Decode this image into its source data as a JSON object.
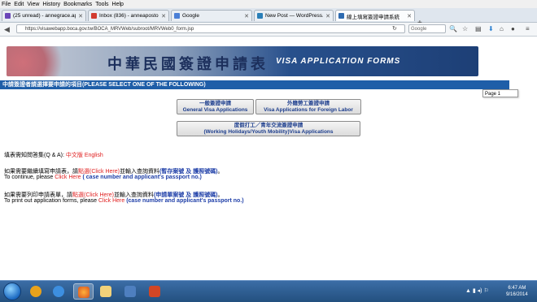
{
  "menu": [
    "File",
    "Edit",
    "View",
    "History",
    "Bookmarks",
    "Tools",
    "Help"
  ],
  "tabs": [
    {
      "title": "(25 unread) - annegrace.ap...",
      "color": "#6a46b8"
    },
    {
      "title": "Inbox (836) - anneaposto...",
      "color": "#d23b2f"
    },
    {
      "title": "Google",
      "color": "#4a7fd6"
    },
    {
      "title": "New Post — WordPress.com",
      "color": "#2a7fb8"
    },
    {
      "title": "線上填寫簽證申請系統",
      "color": "#2e6bb0"
    }
  ],
  "url": "https://visawebapp.boca.gov.tw/BOCA_MRVWeb/subroot/MRVWeb0_form.jsp",
  "search_placeholder": "Google",
  "banner": {
    "zh": "中華民國簽證申請表",
    "en": "VISA APPLICATION FORMS"
  },
  "section_title": "中請簽證者請選擇要申請的項目(PLEASE SELECT ONE OF THE FOLLOWING)",
  "page_tooltip": "Page 1",
  "buttons": {
    "general_zh": "一般簽證申請",
    "general_en": "General Visa Applications",
    "labor_zh": "外籍勞工簽證申請",
    "labor_en": "Visa Applications for Foreign Labor",
    "holiday_zh": "度假打工／青年交流簽證申請",
    "holiday_en": "(Working Holidays/Youth Mobility)Visa Applications"
  },
  "qa": {
    "label": "填表需知問答集(Q & A):",
    "zh": "中文版",
    "en": "English"
  },
  "continue": {
    "zh_pre": "如果需要繼續填寫申請表，請",
    "zh_link": "點選(Click Here)",
    "zh_mid": "並輸入查詢資料",
    "zh_req": "(暫存案號 及 護照號碼)",
    "zh_end": "。",
    "en_pre": "To continue, please ",
    "en_link": "Click Here",
    "en_req": " ( case number and applicant's passport no.)"
  },
  "print": {
    "zh_pre": "如果需要列印申請表單，請",
    "zh_link": "點選(Click Here)",
    "zh_mid": "並輸入查詢資料",
    "zh_req": "(申請單案號 及 護照號碼)",
    "zh_end": "。",
    "en_pre": "To print out application forms, please ",
    "en_link": "Click Here",
    "en_req": " (case number and applicant's passport no.)"
  },
  "clock": {
    "time": "6:47 AM",
    "date": "9/16/2014"
  }
}
